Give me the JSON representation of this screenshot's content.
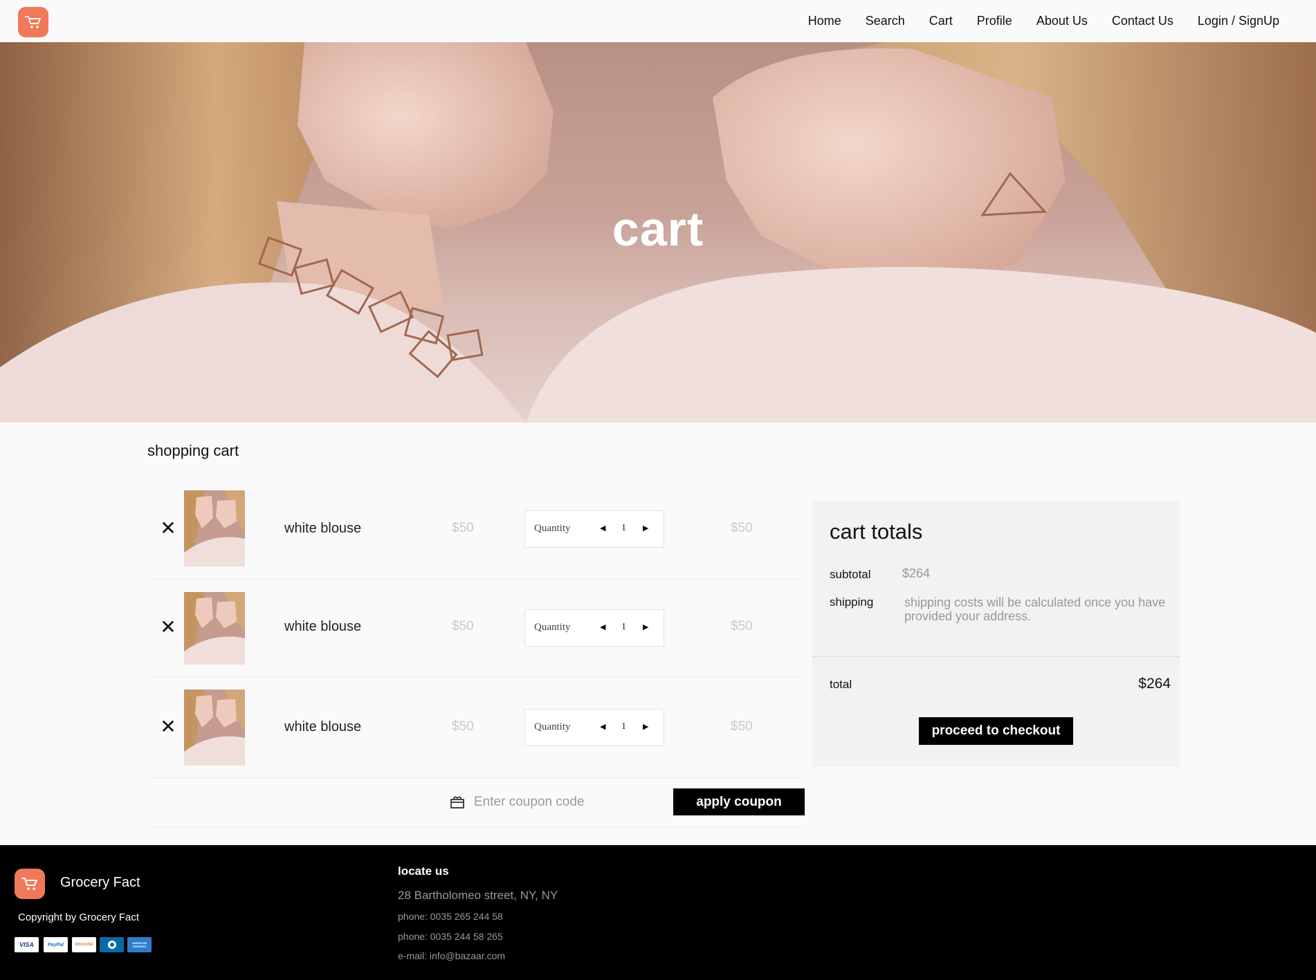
{
  "nav": {
    "links": [
      "Home",
      "Search",
      "Cart",
      "Profile",
      "About Us",
      "Contact Us",
      "Login / SignUp"
    ]
  },
  "hero": {
    "title": "cart"
  },
  "cart": {
    "heading": "shopping cart",
    "quantity_label": "Quantity",
    "items": [
      {
        "name": "white blouse",
        "price": "$50",
        "quantity": "1",
        "total": "$50"
      },
      {
        "name": "white blouse",
        "price": "$50",
        "quantity": "1",
        "total": "$50"
      },
      {
        "name": "white blouse",
        "price": "$50",
        "quantity": "1",
        "total": "$50"
      }
    ],
    "coupon_placeholder": "Enter coupon code",
    "apply_label": "apply coupon"
  },
  "totals": {
    "title": "cart totals",
    "subtotal_label": "subtotal",
    "subtotal_value": "$264",
    "shipping_label": "shipping",
    "shipping_value": "shipping costs will be calculated once you have provided your address.",
    "total_label": "total",
    "total_value": "$264",
    "checkout_label": "proceed to checkout"
  },
  "footer": {
    "brand": "Grocery Fact",
    "copyright": "Copyright by Grocery Fact",
    "payment_methods": [
      {
        "name": "VISA",
        "bg": "#ffffff",
        "fg": "#1a3a8e"
      },
      {
        "name": "PayPal",
        "bg": "#ffffff",
        "fg": "#1f6fc4"
      },
      {
        "name": "DISCOVER",
        "bg": "#ffffff",
        "fg": "#e07a2a"
      },
      {
        "name": "diners-club",
        "bg": "#0a6aa8",
        "fg": "#ffffff"
      },
      {
        "name": "AMERICAN EXPRESS",
        "bg": "#2f7ccc",
        "fg": "#ffffff"
      }
    ],
    "locate_heading": "locate us",
    "address": "28 Bartholomeo street, NY, NY",
    "phone1": "phone: 0035 265 244 58",
    "phone2": "phone: 0035 244 58 265",
    "email": "e-mail: info@bazaar.com"
  },
  "colors": {
    "brand": "#f0795a",
    "button": "#000000",
    "muted_price": "#c9c9c9"
  },
  "icons": {
    "logo": "cart-icon",
    "remove": "close-icon",
    "coupon": "gift-icon",
    "qty_dec": "caret-left-icon",
    "qty_inc": "caret-right-icon"
  }
}
